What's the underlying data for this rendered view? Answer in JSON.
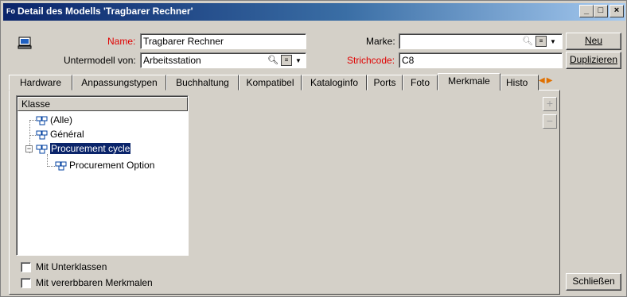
{
  "window": {
    "title": "Detail des Modells 'Tragbarer Rechner'",
    "controls": [
      "_",
      "□",
      "×"
    ]
  },
  "form": {
    "name_label": "Name:",
    "name_value": "Tragbarer Rechner",
    "submodel_label": "Untermodell von:",
    "submodel_value": "Arbeitsstation",
    "brand_label": "Marke:",
    "brand_value": "",
    "barcode_label": "Strichcode:",
    "barcode_value": "C8"
  },
  "buttons": {
    "new": "Neu",
    "duplicate": "Duplizieren",
    "close": "Schließen"
  },
  "tabs": [
    {
      "label": "Hardware"
    },
    {
      "label": "Anpassungstypen"
    },
    {
      "label": "Buchhaltung"
    },
    {
      "label": "Kompatibel"
    },
    {
      "label": "Kataloginfo"
    },
    {
      "label": "Ports"
    },
    {
      "label": "Foto"
    },
    {
      "label": "Merkmale",
      "active": true
    },
    {
      "label": "Histo"
    }
  ],
  "tree": {
    "header": "Klasse",
    "nodes": [
      {
        "label": "(Alle)"
      },
      {
        "label": "Général"
      },
      {
        "label": "Procurement cycle",
        "selected": true,
        "expanded": true
      },
      {
        "label": "Procurement Option"
      }
    ]
  },
  "side_buttons": {
    "add": "+",
    "remove": "−"
  },
  "options": {
    "subclasses": "Mit Unterklassen",
    "inheritable": "Mit vererbbaren Merkmalen"
  },
  "icons": {
    "title": "model-detail-icon",
    "model": "laptop-icon",
    "search": "magnifier-icon",
    "detail": "detail-box-icon",
    "tree_node": "feature-class-icon"
  }
}
